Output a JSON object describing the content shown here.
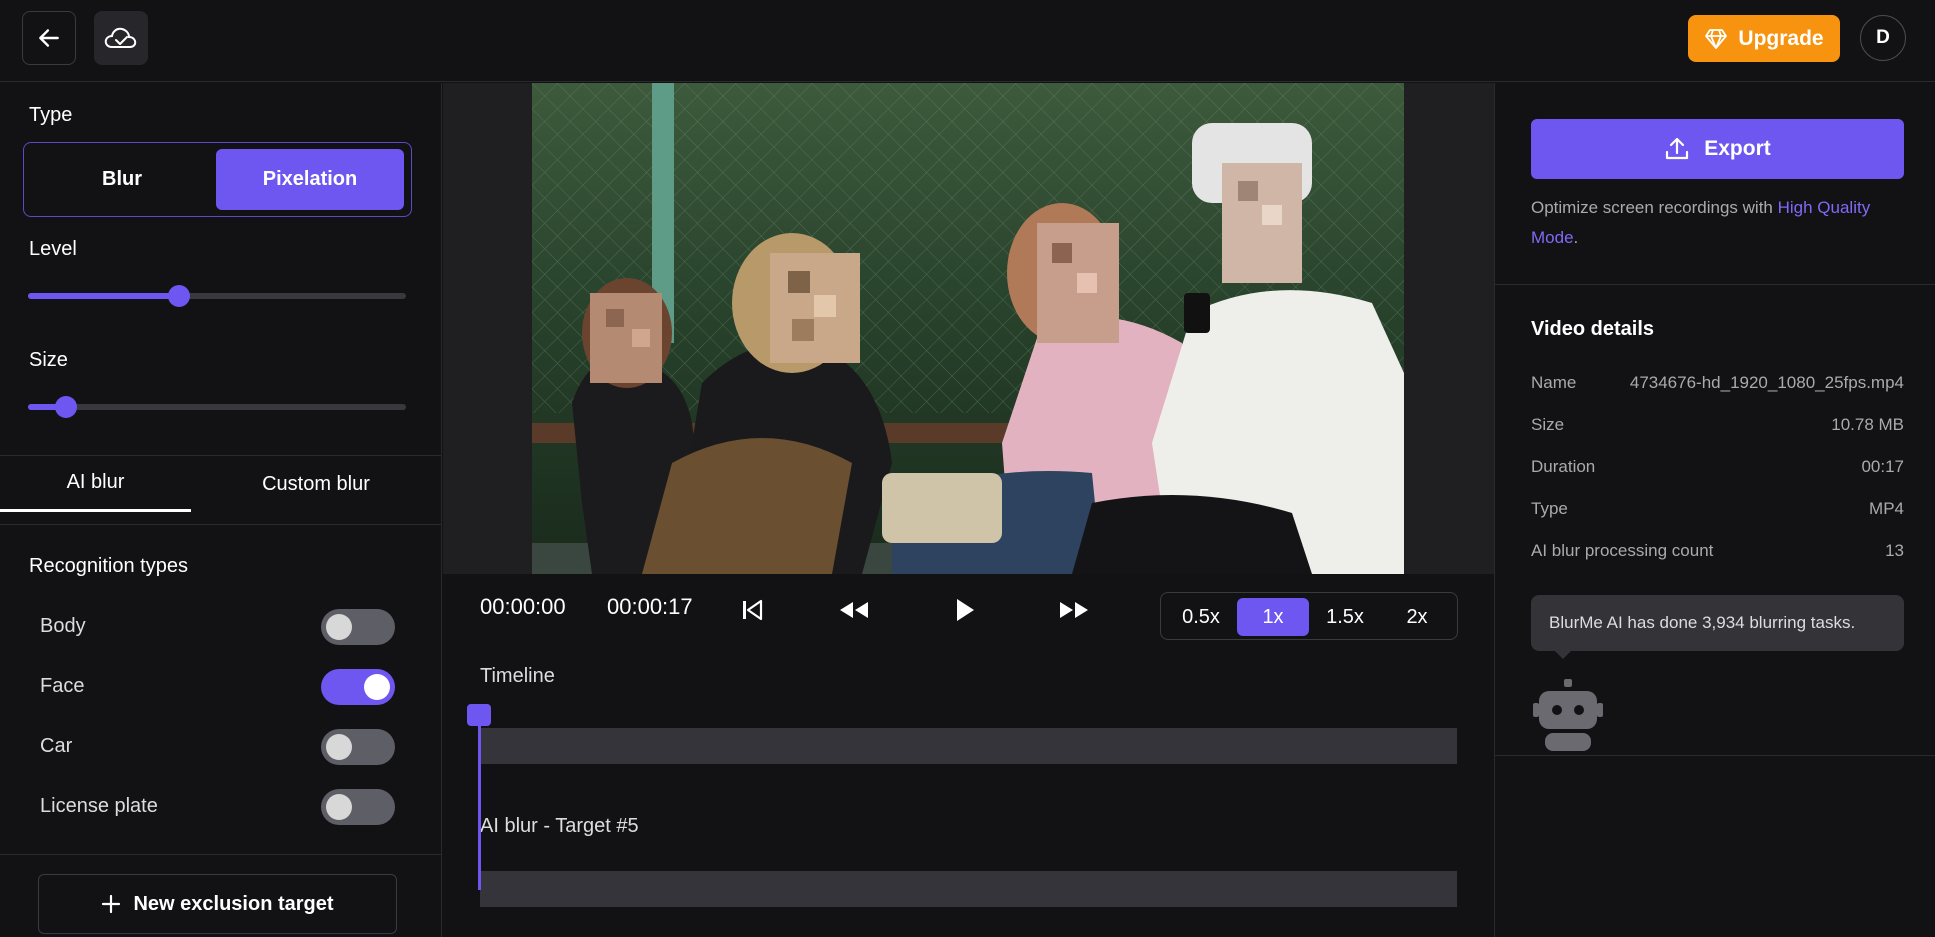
{
  "topbar": {
    "upgrade_label": "Upgrade",
    "avatar_initial": "D"
  },
  "left": {
    "type_label": "Type",
    "type_options": [
      "Blur",
      "Pixelation"
    ],
    "type_selected": "Pixelation",
    "level_label": "Level",
    "level_value": 0.4,
    "size_label": "Size",
    "size_value": 0.1,
    "tabs": [
      "AI blur",
      "Custom blur"
    ],
    "active_tab": "AI blur",
    "recognition_label": "Recognition types",
    "recognition": [
      {
        "label": "Body",
        "on": false
      },
      {
        "label": "Face",
        "on": true
      },
      {
        "label": "Car",
        "on": false
      },
      {
        "label": "License plate",
        "on": false
      }
    ],
    "new_exclusion_label": "New exclusion target"
  },
  "player": {
    "current_time": "00:00:00",
    "duration": "00:00:17",
    "speeds": [
      "0.5x",
      "1x",
      "1.5x",
      "2x"
    ],
    "active_speed": "1x",
    "timeline_label": "Timeline",
    "track2_label": "AI blur - Target #5"
  },
  "right": {
    "export_label": "Export",
    "optimize_text": "Optimize screen recordings with ",
    "optimize_link": "High Quality Mode",
    "optimize_suffix": ".",
    "details_title": "Video details",
    "details": [
      {
        "key": "Name",
        "value": "4734676-hd_1920_1080_25fps.mp4"
      },
      {
        "key": "Size",
        "value": "10.78 MB"
      },
      {
        "key": "Duration",
        "value": "00:17"
      },
      {
        "key": "Type",
        "value": "MP4"
      },
      {
        "key": "AI blur processing count",
        "value": "13"
      }
    ],
    "tooltip": "BlurMe AI has done 3,934 blurring tasks."
  },
  "colors": {
    "accent": "#6e56f0",
    "upgrade": "#f7930f",
    "background": "#121215"
  }
}
